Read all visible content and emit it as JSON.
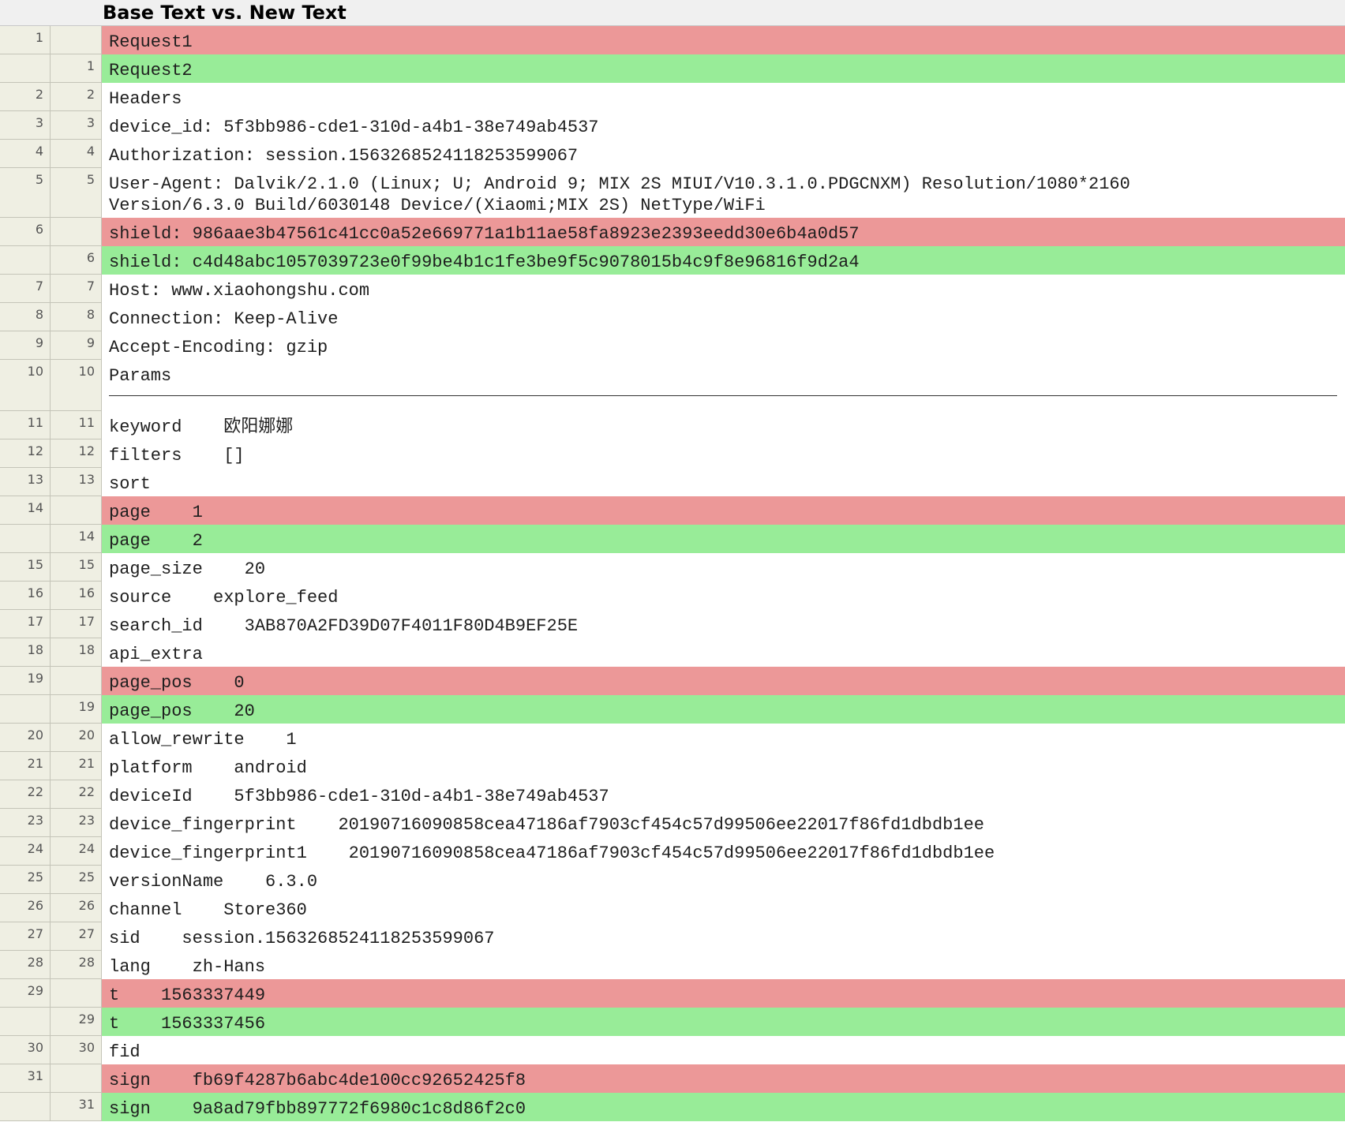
{
  "header": {
    "title": "Base Text vs. New Text"
  },
  "colors": {
    "deleted": "#ec9898",
    "inserted": "#98ec98",
    "gutter": "#efefe3"
  },
  "rows": [
    {
      "old": "1",
      "new": "",
      "type": "del",
      "text": "Request1"
    },
    {
      "old": "",
      "new": "1",
      "type": "ins",
      "text": "Request2"
    },
    {
      "old": "2",
      "new": "2",
      "type": "eq",
      "text": "Headers"
    },
    {
      "old": "3",
      "new": "3",
      "type": "eq",
      "text": "device_id: 5f3bb986-cde1-310d-a4b1-38e749ab4537"
    },
    {
      "old": "4",
      "new": "4",
      "type": "eq",
      "text": "Authorization: session.1563268524118253599067"
    },
    {
      "old": "5",
      "new": "5",
      "type": "eq",
      "text": "User-Agent: Dalvik/2.1.0 (Linux; U; Android 9; MIX 2S MIUI/V10.3.1.0.PDGCNXM) Resolution/1080*2160\nVersion/6.3.0 Build/6030148 Device/(Xiaomi;MIX 2S) NetType/WiFi"
    },
    {
      "old": "6",
      "new": "",
      "type": "del",
      "text": "shield: 986aae3b47561c41cc0a52e669771a1b11ae58fa8923e2393eedd30e6b4a0d57"
    },
    {
      "old": "",
      "new": "6",
      "type": "ins",
      "text": "shield: c4d48abc1057039723e0f99be4b1c1fe3be9f5c9078015b4c9f8e96816f9d2a4"
    },
    {
      "old": "7",
      "new": "7",
      "type": "eq",
      "text": "Host: www.xiaohongshu.com"
    },
    {
      "old": "8",
      "new": "8",
      "type": "eq",
      "text": "Connection: Keep-Alive"
    },
    {
      "old": "9",
      "new": "9",
      "type": "eq",
      "text": "Accept-Encoding: gzip"
    },
    {
      "old": "10",
      "new": "10",
      "type": "eq",
      "text": "Params"
    },
    {
      "old": "11",
      "new": "11",
      "type": "eq",
      "text": "keyword    欧阳娜娜"
    },
    {
      "old": "12",
      "new": "12",
      "type": "eq",
      "text": "filters    []"
    },
    {
      "old": "13",
      "new": "13",
      "type": "eq",
      "text": "sort"
    },
    {
      "old": "14",
      "new": "",
      "type": "del",
      "text": "page    1"
    },
    {
      "old": "",
      "new": "14",
      "type": "ins",
      "text": "page    2"
    },
    {
      "old": "15",
      "new": "15",
      "type": "eq",
      "text": "page_size    20"
    },
    {
      "old": "16",
      "new": "16",
      "type": "eq",
      "text": "source    explore_feed"
    },
    {
      "old": "17",
      "new": "17",
      "type": "eq",
      "text": "search_id    3AB870A2FD39D07F4011F80D4B9EF25E"
    },
    {
      "old": "18",
      "new": "18",
      "type": "eq",
      "text": "api_extra"
    },
    {
      "old": "19",
      "new": "",
      "type": "del",
      "text": "page_pos    0"
    },
    {
      "old": "",
      "new": "19",
      "type": "ins",
      "text": "page_pos    20"
    },
    {
      "old": "20",
      "new": "20",
      "type": "eq",
      "text": "allow_rewrite    1"
    },
    {
      "old": "21",
      "new": "21",
      "type": "eq",
      "text": "platform    android"
    },
    {
      "old": "22",
      "new": "22",
      "type": "eq",
      "text": "deviceId    5f3bb986-cde1-310d-a4b1-38e749ab4537"
    },
    {
      "old": "23",
      "new": "23",
      "type": "eq",
      "text": "device_fingerprint    20190716090858cea47186af7903cf454c57d99506ee22017f86fd1dbdb1ee"
    },
    {
      "old": "24",
      "new": "24",
      "type": "eq",
      "text": "device_fingerprint1    20190716090858cea47186af7903cf454c57d99506ee22017f86fd1dbdb1ee"
    },
    {
      "old": "25",
      "new": "25",
      "type": "eq",
      "text": "versionName    6.3.0"
    },
    {
      "old": "26",
      "new": "26",
      "type": "eq",
      "text": "channel    Store360"
    },
    {
      "old": "27",
      "new": "27",
      "type": "eq",
      "text": "sid    session.1563268524118253599067"
    },
    {
      "old": "28",
      "new": "28",
      "type": "eq",
      "text": "lang    zh-Hans"
    },
    {
      "old": "29",
      "new": "",
      "type": "del",
      "text": "t    1563337449"
    },
    {
      "old": "",
      "new": "29",
      "type": "ins",
      "text": "t    1563337456"
    },
    {
      "old": "30",
      "new": "30",
      "type": "eq",
      "text": "fid"
    },
    {
      "old": "31",
      "new": "",
      "type": "del",
      "text": "sign    fb69f4287b6abc4de100cc92652425f8"
    },
    {
      "old": "",
      "new": "31",
      "type": "ins",
      "text": "sign    9a8ad79fbb897772f6980c1c8d86f2c0"
    }
  ]
}
